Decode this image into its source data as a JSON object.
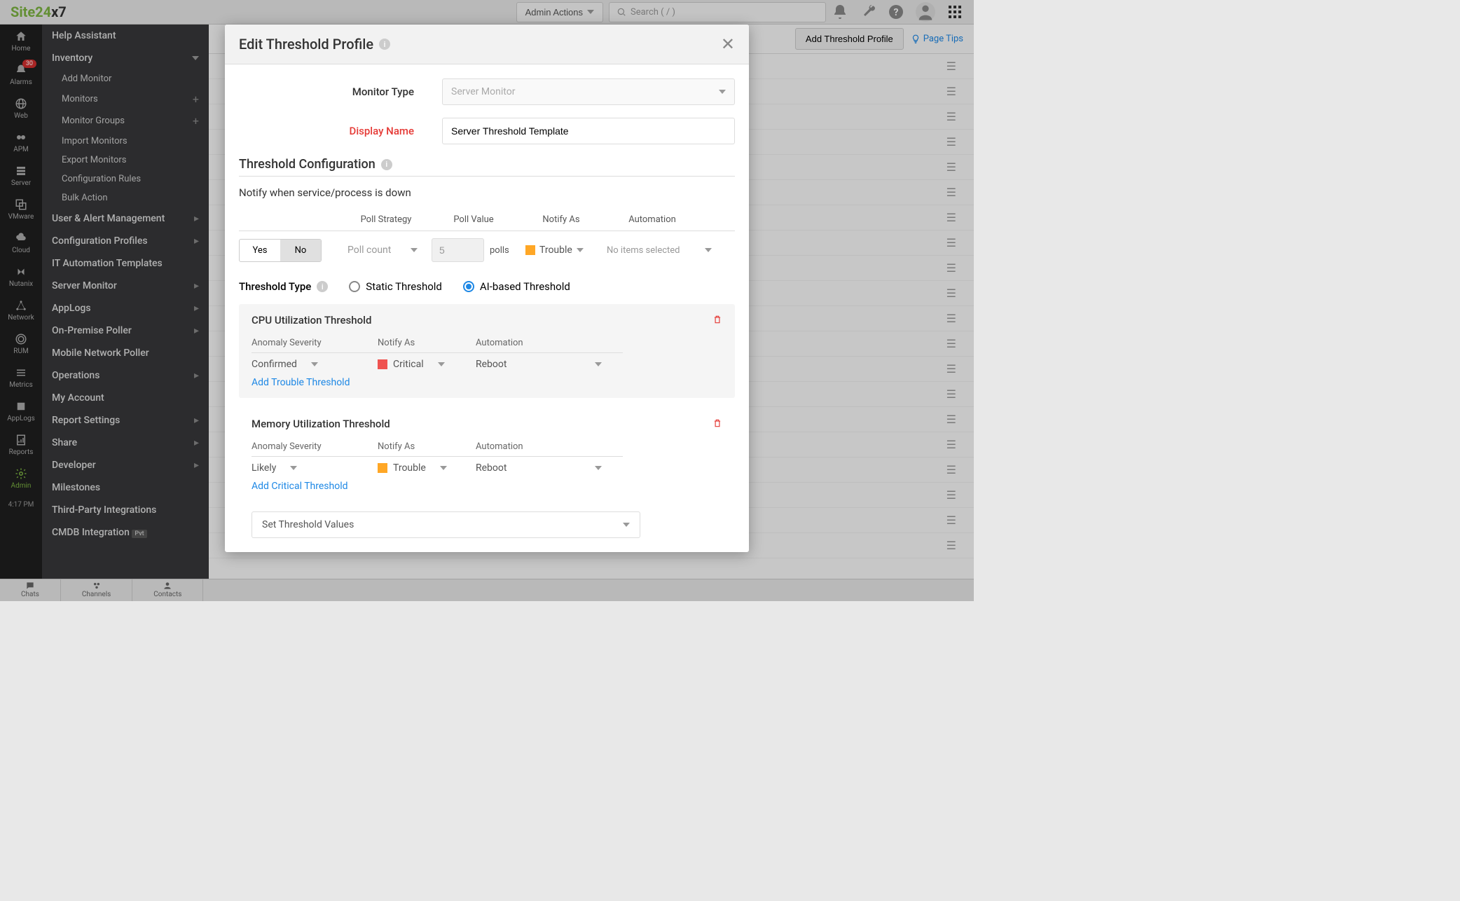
{
  "logo": {
    "brand": "Site24",
    "suffix": "x7"
  },
  "header": {
    "admin_actions": "Admin Actions",
    "search_placeholder": "Search ( / )"
  },
  "icon_sidebar": {
    "home": "Home",
    "alarms": "Alarms",
    "alarms_badge": "30",
    "web": "Web",
    "apm": "APM",
    "server": "Server",
    "vmware": "VMware",
    "cloud": "Cloud",
    "nutanix": "Nutanix",
    "network": "Network",
    "rum": "RUM",
    "metrics": "Metrics",
    "applogs": "AppLogs",
    "reports": "Reports",
    "admin": "Admin",
    "time": "4:17 PM"
  },
  "nav": {
    "help_assistant": "Help Assistant",
    "inventory": "Inventory",
    "add_monitor": "Add Monitor",
    "monitors": "Monitors",
    "monitor_groups": "Monitor Groups",
    "import_monitors": "Import Monitors",
    "export_monitors": "Export Monitors",
    "config_rules": "Configuration Rules",
    "bulk_action": "Bulk Action",
    "user_alert": "User & Alert Management",
    "config_profiles": "Configuration Profiles",
    "it_automation": "IT Automation Templates",
    "server_monitor": "Server Monitor",
    "applogs": "AppLogs",
    "on_premise": "On-Premise Poller",
    "mobile_poller": "Mobile Network Poller",
    "operations": "Operations",
    "my_account": "My Account",
    "report_settings": "Report Settings",
    "share": "Share",
    "developer": "Developer",
    "milestones": "Milestones",
    "third_party": "Third-Party Integrations",
    "cmdb": "CMDB Integration",
    "pvt": "Pvt"
  },
  "bottom": {
    "chats": "Chats",
    "channels": "Channels",
    "contacts": "Contacts"
  },
  "main": {
    "add_threshold": "Add Threshold Profile",
    "page_tips": "Page Tips"
  },
  "modal": {
    "title": "Edit Threshold Profile",
    "monitor_type_label": "Monitor Type",
    "monitor_type_value": "Server Monitor",
    "display_name_label": "Display Name",
    "display_name_value": "Server Threshold Template",
    "threshold_config": "Threshold Configuration",
    "notify_down": "Notify when service/process is down",
    "poll_strategy": "Poll Strategy",
    "poll_value": "Poll Value",
    "notify_as": "Notify As",
    "automation": "Automation",
    "yes": "Yes",
    "no": "No",
    "poll_count": "Poll count",
    "poll_num": "5",
    "polls": "polls",
    "trouble": "Trouble",
    "no_items": "No items selected",
    "threshold_type": "Threshold Type",
    "static_threshold": "Static Threshold",
    "ai_threshold": "AI-based Threshold",
    "cpu_title": "CPU Utilization Threshold",
    "anomaly_severity": "Anomaly Severity",
    "confirmed": "Confirmed",
    "critical": "Critical",
    "reboot": "Reboot",
    "add_trouble": "Add Trouble Threshold",
    "mem_title": "Memory Utilization Threshold",
    "likely": "Likely",
    "add_critical": "Add Critical Threshold",
    "set_threshold": "Set Threshold Values"
  }
}
